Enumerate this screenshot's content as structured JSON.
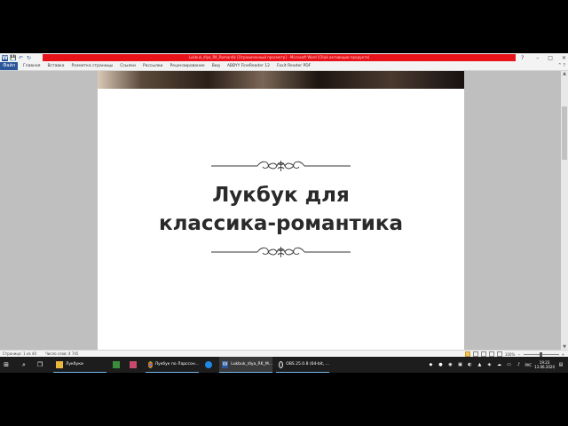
{
  "window": {
    "title": "Lukbuk_dlya_RK_Romantik [Ограниченный просмотр] - Microsoft Word (Сбой активации продукта)",
    "help_glyph": "?",
    "minimize_glyph": "–",
    "maximize_glyph": "□",
    "close_glyph": "✕"
  },
  "qat": {
    "word_logo": "W",
    "save": "💾",
    "undo": "↶",
    "redo": "↻"
  },
  "ribbon": {
    "file_tab": "Файл",
    "tabs": [
      "Главная",
      "Вставка",
      "Разметка страницы",
      "Ссылки",
      "Рассылки",
      "Рецензирование",
      "Вид",
      "ABBYY FineReader 12",
      "Foxit Reader PDF"
    ],
    "collapse_glyph": "^ ?"
  },
  "document": {
    "title_line1": "Лукбук для",
    "title_line2": "классика-романтика"
  },
  "scrollbar": {
    "up_glyph": "▲",
    "down_glyph": "▼"
  },
  "status_bar": {
    "page": "Страница: 1 из 40",
    "word_count": "Число слов: 4 745",
    "zoom": "100%",
    "zoom_out": "−",
    "zoom_in": "+"
  },
  "taskbar": {
    "start_glyph": "⊞",
    "search_glyph": "⌕",
    "taskview_glyph": "❐",
    "items": [
      {
        "label": "Лукбуки"
      },
      {
        "label": ""
      },
      {
        "label": ""
      },
      {
        "label": "Лукбук по Ларссон..."
      },
      {
        "label": ""
      },
      {
        "label": "Lukbuk_dlya_RK_M..."
      },
      {
        "label": "OBS 25.0.8 (64-bit, ..."
      }
    ],
    "language": "РУС",
    "time": "19:23",
    "date": "13.06.2020"
  },
  "colors": {
    "title_red": "#e8131a",
    "word_blue": "#2b579a",
    "taskbar_bg": "#1d1d1d"
  }
}
